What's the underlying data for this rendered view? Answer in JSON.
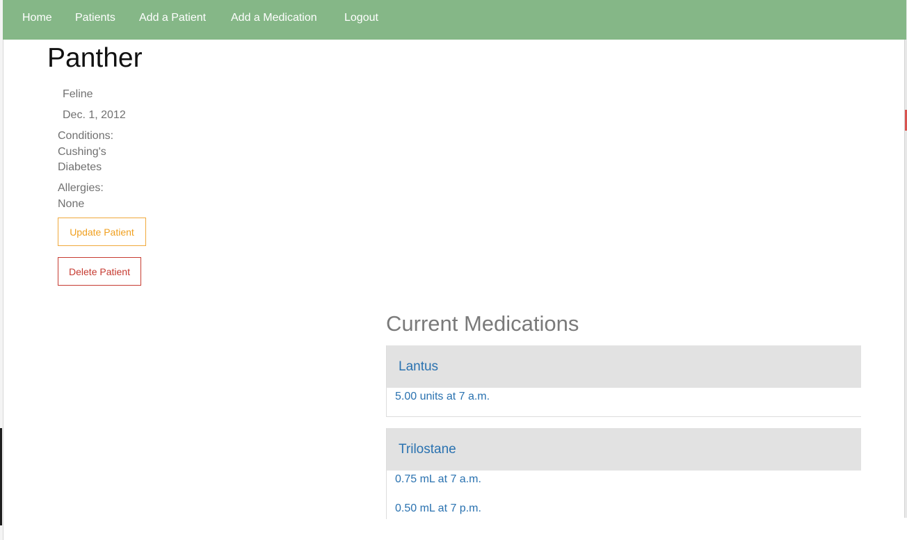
{
  "nav": {
    "home": "Home",
    "patients": "Patients",
    "add_patient": "Add a Patient",
    "add_medication": "Add a Medication",
    "logout": "Logout"
  },
  "patient": {
    "name": "Panther",
    "species": "Feline",
    "dob": "Dec. 1, 2012",
    "conditions_label": "Conditions:",
    "conditions": [
      "Cushing's",
      "Diabetes"
    ],
    "allergies_label": "Allergies:",
    "allergies": [
      "None"
    ]
  },
  "actions": {
    "update": "Update Patient",
    "delete": "Delete Patient"
  },
  "medications": {
    "title": "Current Medications",
    "items": [
      {
        "name": "Lantus",
        "doses": [
          "5.00 units at 7 a.m."
        ]
      },
      {
        "name": "Trilostane",
        "doses": [
          "0.75 mL at 7 a.m.",
          "0.50 mL at 7 p.m."
        ]
      }
    ]
  },
  "colors": {
    "navbar": "#85b787",
    "update_accent": "#f0a020",
    "delete_accent": "#c63a30",
    "link": "#2a72b0",
    "card_header": "#e2e2e2"
  }
}
